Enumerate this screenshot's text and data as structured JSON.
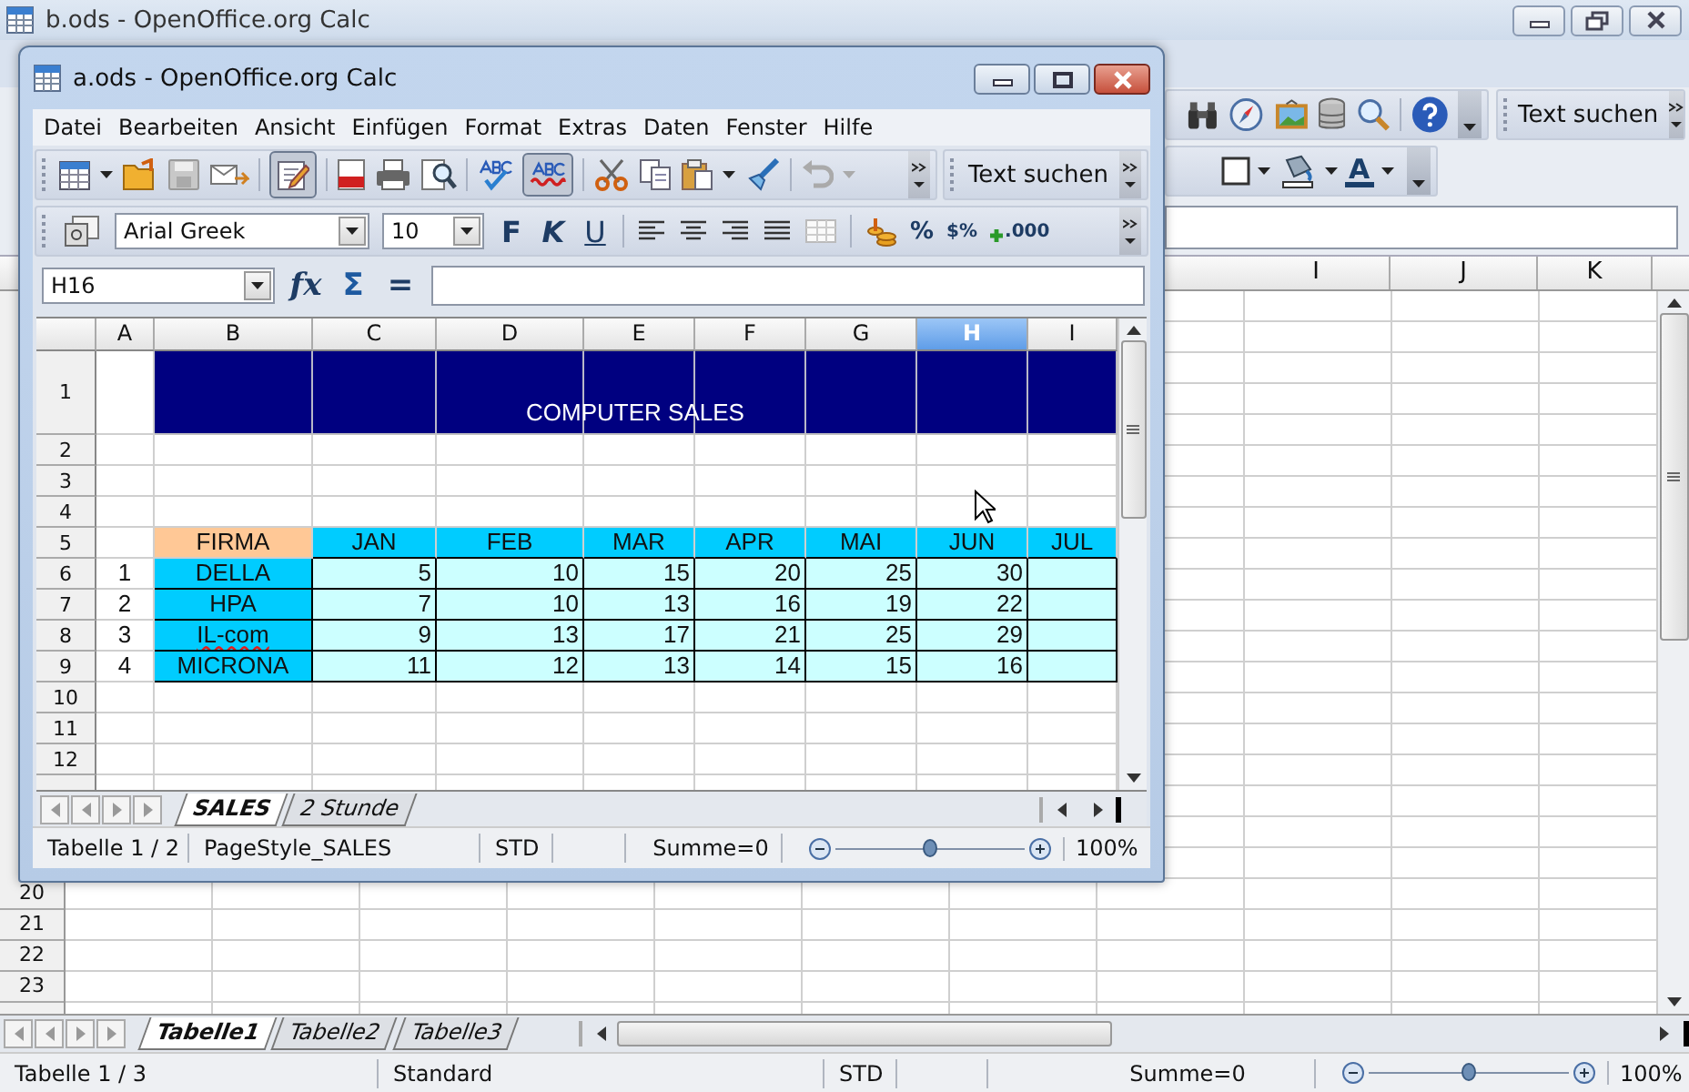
{
  "background_window": {
    "title": "b.ods - OpenOffice.org Calc",
    "find_toolbar": {
      "label": "Text suchen"
    },
    "font_color_button": {
      "label": "A"
    },
    "column_headers": [
      {
        "label": "I",
        "selected": false
      },
      {
        "label": "J",
        "selected": false
      },
      {
        "label": "K",
        "selected": false
      }
    ],
    "row_headers": [
      "20",
      "21",
      "22",
      "23"
    ],
    "sheet_tabs": [
      {
        "label": "Tabelle1",
        "selected": true
      },
      {
        "label": "Tabelle2",
        "selected": false
      },
      {
        "label": "Tabelle3",
        "selected": false
      }
    ],
    "status_bar": {
      "sheet": "Tabelle 1 / 3",
      "page_style": "Standard",
      "selection_mode": "STD",
      "sum": "Summe=0",
      "zoom": {
        "level": 0.5,
        "reading": "100%"
      }
    }
  },
  "window": {
    "title": "a.ods - OpenOffice.org Calc",
    "menu": [
      "Datei",
      "Bearbeiten",
      "Ansicht",
      "Einfügen",
      "Format",
      "Extras",
      "Daten",
      "Fenster",
      "Hilfe"
    ],
    "find_toolbar": {
      "label": "Text suchen"
    },
    "font_name": "Arial Greek",
    "font_size": "10",
    "format_buttons": [
      {
        "kind": "bold",
        "label": "F"
      },
      {
        "kind": "italic",
        "label": "K"
      },
      {
        "kind": "underline",
        "label": "U"
      }
    ],
    "number_buttons": [
      {
        "kind": "percent",
        "label": "%"
      },
      {
        "kind": "standard",
        "label": "$%"
      },
      {
        "kind": "add_decimal",
        "label": ".000"
      }
    ],
    "name_box": "H16",
    "formula_buttons": [
      {
        "kind": "wizard",
        "label": "fx"
      },
      {
        "kind": "sum",
        "label": "Σ"
      },
      {
        "kind": "equals",
        "label": "="
      }
    ],
    "sheet": {
      "columns": [
        {
          "label": "A",
          "selected": false
        },
        {
          "label": "B",
          "selected": false
        },
        {
          "label": "C",
          "selected": false
        },
        {
          "label": "D",
          "selected": false
        },
        {
          "label": "E",
          "selected": false
        },
        {
          "label": "F",
          "selected": false
        },
        {
          "label": "G",
          "selected": false
        },
        {
          "label": "H",
          "selected": true
        },
        {
          "label": "I",
          "selected": false
        }
      ],
      "rows": [
        {
          "label": "1",
          "kind": "title",
          "text": "COMPUTER SALES"
        },
        {
          "label": "2",
          "kind": "blank"
        },
        {
          "label": "3",
          "kind": "blank"
        },
        {
          "label": "4",
          "kind": "blank"
        },
        {
          "label": "5",
          "kind": "header",
          "name": "FIRMA",
          "months": [
            "JAN",
            "FEB",
            "MAR",
            "APR",
            "MAI",
            "JUN",
            "JUL"
          ]
        },
        {
          "label": "6",
          "kind": "data",
          "index": "1",
          "name": {
            "text": "DELLA",
            "spell_error": false
          },
          "values": [
            "5",
            "10",
            "15",
            "20",
            "25",
            "30"
          ]
        },
        {
          "label": "7",
          "kind": "data",
          "index": "2",
          "name": {
            "text": "HPA",
            "spell_error": false
          },
          "values": [
            "7",
            "10",
            "13",
            "16",
            "19",
            "22"
          ]
        },
        {
          "label": "8",
          "kind": "data",
          "index": "3",
          "name": {
            "text": "IL-com",
            "spell_error": true
          },
          "values": [
            "9",
            "13",
            "17",
            "21",
            "25",
            "29"
          ]
        },
        {
          "label": "9",
          "kind": "data",
          "index": "4",
          "name": {
            "text": "MICRONA",
            "spell_error": false
          },
          "values": [
            "11",
            "12",
            "13",
            "14",
            "15",
            "16"
          ]
        },
        {
          "label": "10",
          "kind": "blank"
        },
        {
          "label": "11",
          "kind": "blank"
        },
        {
          "label": "12",
          "kind": "blank"
        }
      ]
    },
    "sheet_tabs": [
      {
        "label": "SALES",
        "selected": true
      },
      {
        "label": "2 Stunde",
        "selected": false
      }
    ],
    "status_bar": {
      "sheet": "Tabelle 1 / 2",
      "page_style": "PageStyle_SALES",
      "selection_mode": "STD",
      "sum": "Summe=0",
      "zoom": {
        "level": 0.5,
        "reading": "100%"
      }
    }
  }
}
